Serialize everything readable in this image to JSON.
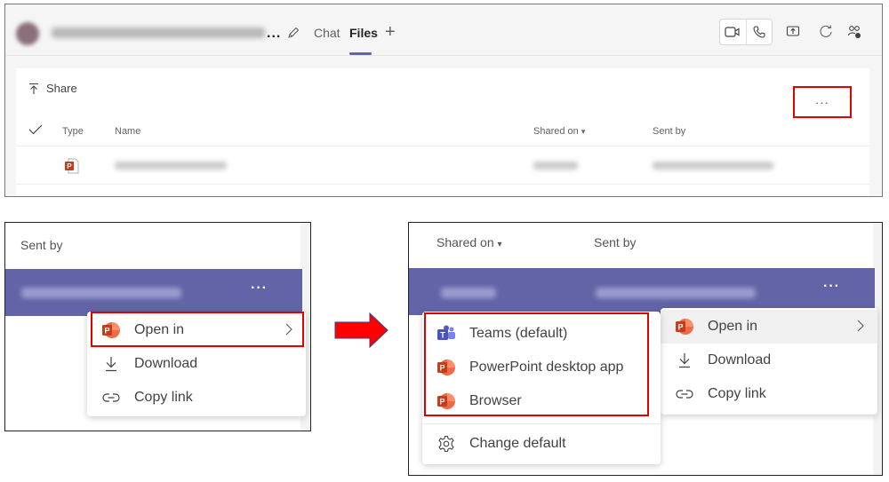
{
  "top_panel": {
    "header": {
      "conversation_title": "[blurred chat name]",
      "tabs": [
        {
          "label": "Chat",
          "active": false
        },
        {
          "label": "Files",
          "active": true
        }
      ],
      "icons": [
        "video-call-icon",
        "audio-call-icon",
        "share-screen-icon",
        "refresh-icon",
        "people-icon"
      ]
    },
    "toolbar": {
      "share_label": "Share"
    },
    "table": {
      "columns": [
        "Type",
        "Name",
        "Shared on",
        "Sent by"
      ],
      "sort_indicator": "▾",
      "rows": [
        {
          "type": "PowerPoint",
          "name": "[blurred file name].pptx",
          "shared_on": "[blurred]",
          "sent_by": "[blurred]",
          "more_label": "···"
        }
      ]
    }
  },
  "step1_panel": {
    "column_header": "Sent by",
    "row_more_label": "···",
    "context_menu": [
      {
        "label": "Open in",
        "icon": "powerpoint-icon",
        "has_submenu": true,
        "highlighted_box": true
      },
      {
        "label": "Download",
        "icon": "download-icon"
      },
      {
        "label": "Copy link",
        "icon": "link-icon"
      }
    ]
  },
  "step2_panel": {
    "column_headers": [
      "Shared on",
      "Sent by"
    ],
    "sort_indicator": "▾",
    "row_more_label": "···",
    "context_menu": [
      {
        "label": "Open in",
        "icon": "powerpoint-icon",
        "has_submenu": true,
        "hovered": true
      },
      {
        "label": "Download",
        "icon": "download-icon"
      },
      {
        "label": "Copy link",
        "icon": "link-icon"
      }
    ],
    "submenu": [
      {
        "label": "Teams (default)",
        "icon": "teams-icon"
      },
      {
        "label": "PowerPoint desktop app",
        "icon": "powerpoint-icon"
      },
      {
        "label": "Browser",
        "icon": "powerpoint-icon"
      },
      {
        "label": "Change default",
        "icon": "gear-icon"
      }
    ]
  },
  "colors": {
    "accent": "#6264a7",
    "highlight_box": "#e00000",
    "arrow": "#ff0000",
    "powerpoint": "#c43e1c"
  }
}
